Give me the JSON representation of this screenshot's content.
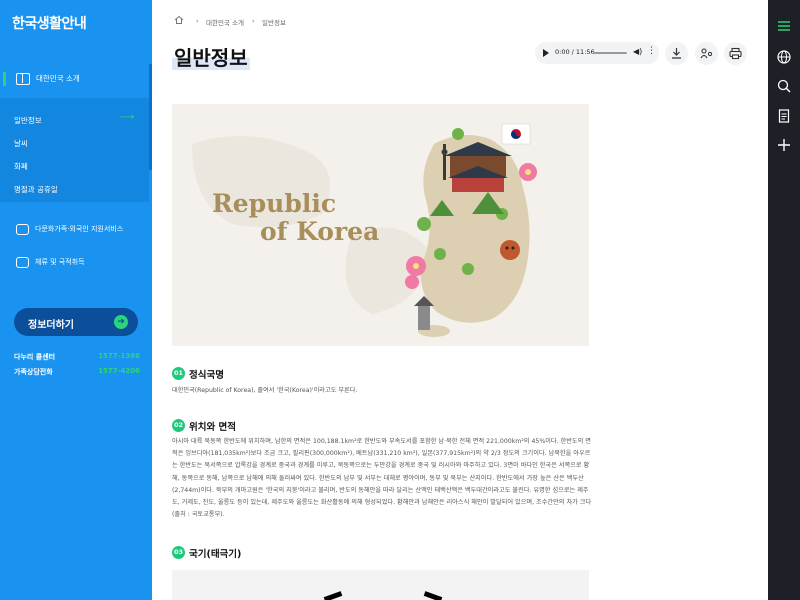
{
  "sidebar": {
    "brand": "한국생활안내",
    "top_item": "대한민국 소개",
    "sub_items": [
      "일반정보",
      "날씨",
      "화폐",
      "명절과 공휴일"
    ],
    "items": [
      "다문화가족·외국인 지원서비스",
      "체류 및 국적취득"
    ],
    "donate_label": "정보더하기",
    "contacts": [
      {
        "name": "다누리 콜센터",
        "phone": "1577-1366"
      },
      {
        "name": "가족상담전화",
        "phone": "1577-4206"
      }
    ],
    "accent_color": "#2bd47a",
    "bg_color": "#1a93f0"
  },
  "breadcrumb": {
    "home_icon": "home-icon",
    "items": [
      "대한민국 소개",
      "일반정보"
    ]
  },
  "page": {
    "title": "일반정보"
  },
  "player": {
    "time": "0:00 / 11:56"
  },
  "toolbar": {
    "icons": [
      "download-icon",
      "share-icon",
      "print-icon"
    ]
  },
  "hero": {
    "line1": "Republic",
    "line2": "of Korea"
  },
  "sections": [
    {
      "num": "01",
      "title": "정식국명",
      "body": "대한민국(Republic of Korea), 줄여서 '한국(Korea)'이라고도 부른다."
    },
    {
      "num": "02",
      "title": "위치와 면적",
      "body": "아시아 대륙 북동쪽 한반도에 위치하며, 남한의 면적은 100,188.1km²로 한반도와 부속도서를 포함한 남·북한 전체 면적 221,000km²의 45%이다. 한반도의 면적은 잉브디아(181,035km²)보다 조금 크고, 필리핀(300,000km²), 베트남(331,210 km²), 일본(377,915km²)의 약 2/3 정도의 크기이다. 남북한을 아우르는 한반도는 북서쪽으로 압록강을 경계로 중국과 경계를 이루고, 북동쪽으로는 두만강을 경계로 중국 및 러시아와 마주하고 있다. 3면이 바다인 한국은 서쪽으로 황해, 동쪽으로 동해, 남쪽으로 남해에 의해 둘러싸여 있다. 한반도의 남부 및 서부는 대체로 평야이며, 동부 및 북부는 산지이다. 한반도에서 가장 높은 산은 백두산(2,744m)이다. 북부의 개마고원은 '한국의 지붕'이라고 불리며, 반도의 동해안을 따라 달리는 산맥인 태백산맥은 백두대간이라고도 불린다. 유명한 섬으로는 제주도, 거제도, 진도, 울릉도 등이 있는데, 제주도와 울릉도는 화산활동에 의해 형성되었다. 황해안과 남해안은 리아스식 해안이 발달되어 있으며, 조수간만의 차가 크다(출처 : 국토교통부)."
    },
    {
      "num": "03",
      "title": "국기(태극기)",
      "body": ""
    }
  ],
  "rail": {
    "icons": [
      "menu-icon",
      "globe-icon",
      "search-icon",
      "document-icon",
      "plus-icon"
    ]
  }
}
